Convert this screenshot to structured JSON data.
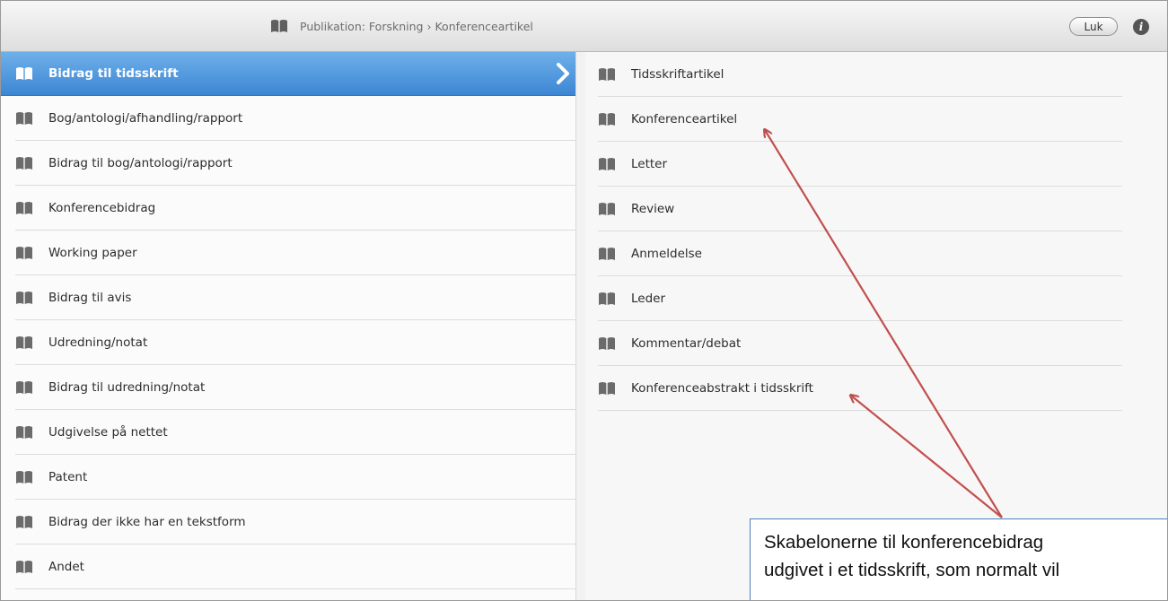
{
  "header": {
    "breadcrumb_root": "Publikation: Forskning",
    "breadcrumb_separator": "›",
    "breadcrumb_current": "Konferenceartikel",
    "close_label": "Luk",
    "info_icon": "info-icon"
  },
  "left_column": {
    "items": [
      {
        "label": "Bidrag til tidsskrift",
        "selected": true
      },
      {
        "label": "Bog/antologi/afhandling/rapport"
      },
      {
        "label": "Bidrag til bog/antologi/rapport"
      },
      {
        "label": "Konferencebidrag"
      },
      {
        "label": "Working paper"
      },
      {
        "label": "Bidrag til avis"
      },
      {
        "label": "Udredning/notat"
      },
      {
        "label": "Bidrag til udredning/notat"
      },
      {
        "label": "Udgivelse på nettet"
      },
      {
        "label": "Patent"
      },
      {
        "label": "Bidrag der ikke har en tekstform"
      },
      {
        "label": "Andet"
      }
    ]
  },
  "right_column": {
    "items": [
      {
        "label": "Tidsskriftartikel"
      },
      {
        "label": "Konferenceartikel"
      },
      {
        "label": "Letter"
      },
      {
        "label": "Review"
      },
      {
        "label": "Anmeldelse"
      },
      {
        "label": "Leder"
      },
      {
        "label": "Kommentar/debat"
      },
      {
        "label": "Konferenceabstrakt i tidsskrift"
      }
    ]
  },
  "annotation": {
    "line1": "Skabelonerne til konferencebidrag",
    "line2": "udgivet i et tidsskrift, som normalt vil"
  },
  "colors": {
    "selected_bg": "#4a93dd",
    "arrow": "#c0504d",
    "callout_border": "#4f81bd"
  }
}
